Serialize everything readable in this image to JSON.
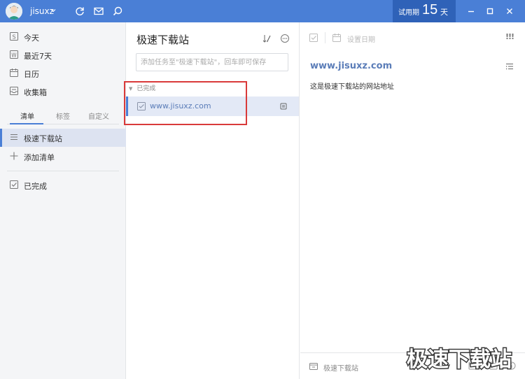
{
  "titlebar": {
    "username": "jisuxz",
    "trial_label": "试用期",
    "trial_days": "15",
    "trial_unit": "天",
    "icons": [
      "user-avatar",
      "chevron-down-icon",
      "sync-icon",
      "mail-icon",
      "search-icon",
      "minimize-icon",
      "maximize-icon",
      "close-icon"
    ]
  },
  "sidebar": {
    "smart_lists": [
      {
        "label": "今天",
        "icon": "today-icon"
      },
      {
        "label": "最近7天",
        "icon": "week-icon"
      },
      {
        "label": "日历",
        "icon": "calendar-icon"
      },
      {
        "label": "收集箱",
        "icon": "inbox-icon"
      }
    ],
    "tabs": [
      "清单",
      "标签",
      "自定义"
    ],
    "lists": [
      {
        "label": "极速下载站",
        "selected": true
      },
      {
        "label": "添加清单"
      }
    ],
    "completed": "已完成"
  },
  "middle": {
    "title": "极速下载站",
    "add_placeholder": "添加任务至\"极速下载站\"，回车即可保存",
    "section": "已完成",
    "tasks": [
      {
        "title": "www.jisuxz.com",
        "done": true
      }
    ]
  },
  "detail": {
    "due_label": "设置日期",
    "priority": "!!!",
    "title": "www.jisuxz.com",
    "description": "这是极速下载站的网站地址",
    "footer_list": "极速下载站"
  },
  "watermark": "极速下载站",
  "colors": {
    "accent": "#4a7fd6",
    "highlight": "#d93a3a",
    "task_link": "#5b7db8"
  }
}
